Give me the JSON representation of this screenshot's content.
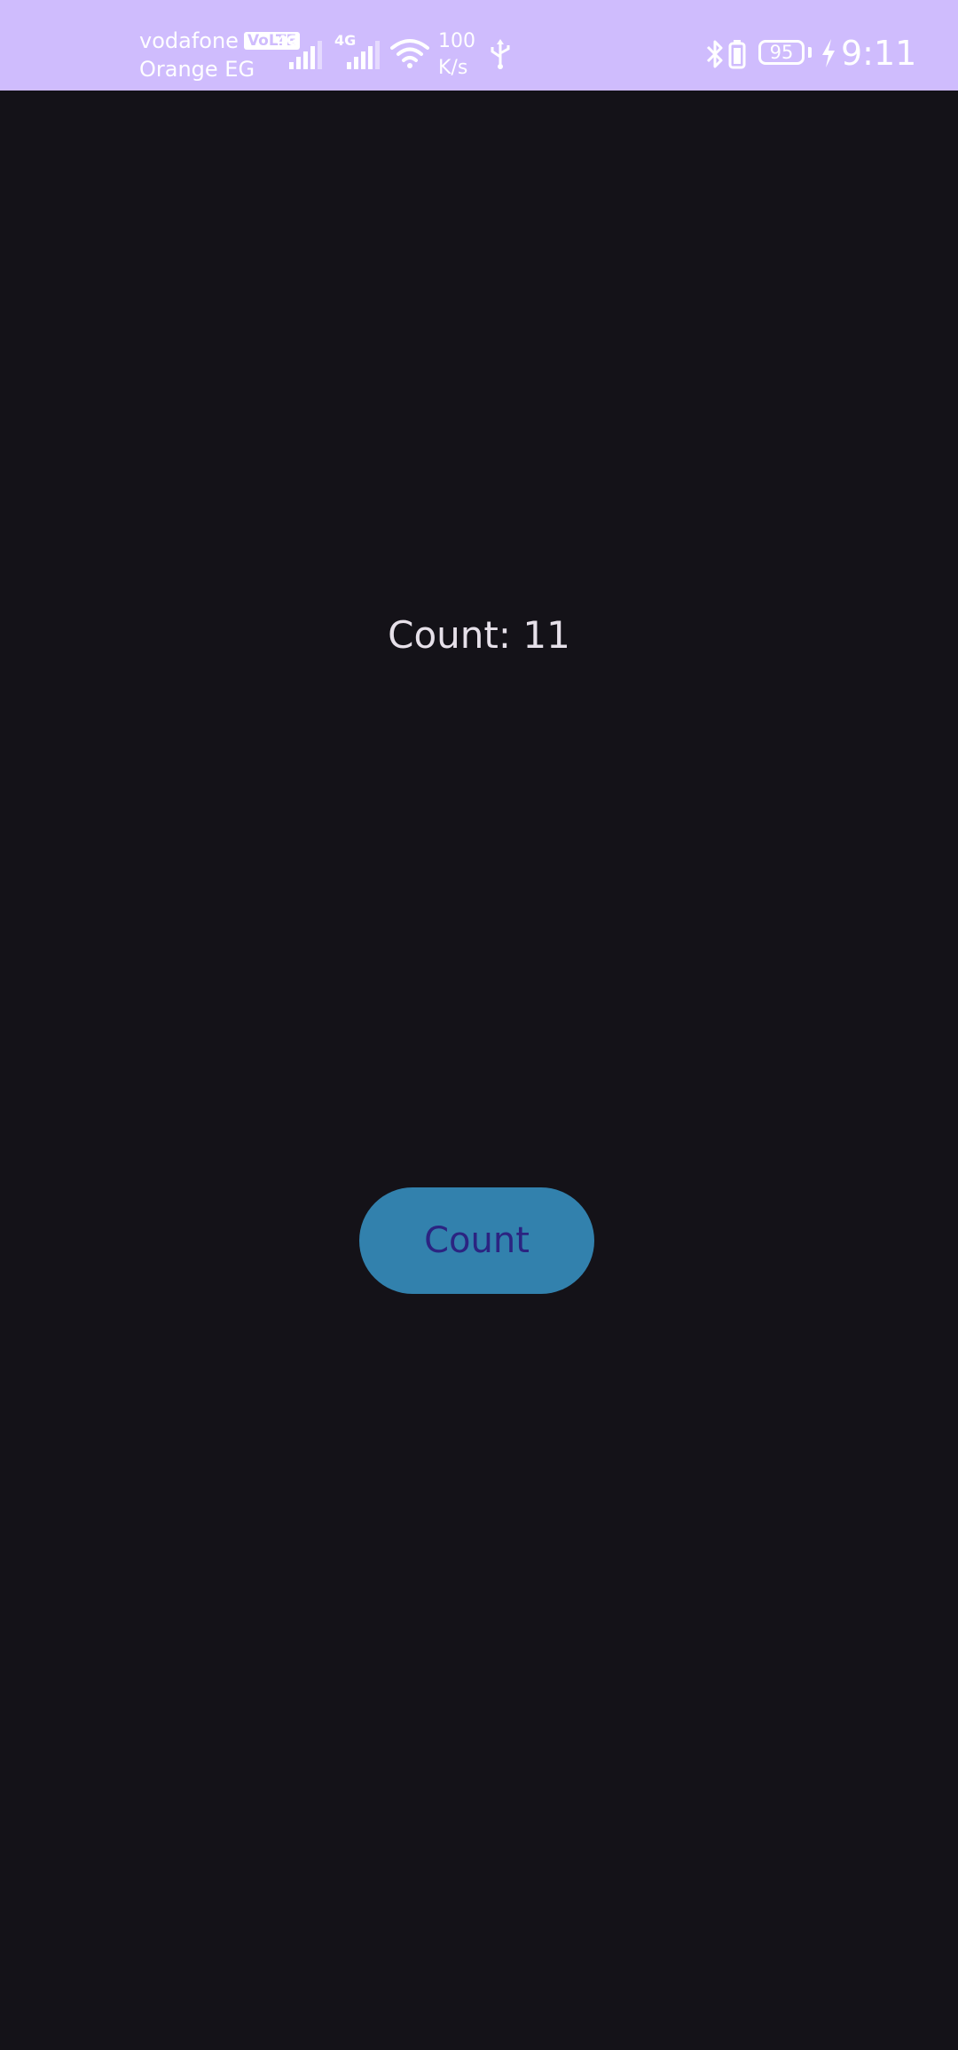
{
  "status_bar": {
    "carrier_1": "vodafone",
    "carrier_1_badge": "VoLTE",
    "carrier_2": "Orange EG",
    "sim1_network": "4G",
    "sim2_network": "4G",
    "speed_value": "100",
    "speed_unit": "K/s",
    "battery_level": "95",
    "time": "9:11",
    "icons": [
      "signal-icon",
      "wifi-icon",
      "usb-icon",
      "bluetooth-icon",
      "battery-icon",
      "charging-icon"
    ],
    "background_color": "#cfbcfd"
  },
  "main": {
    "count_label": "Count: 11",
    "button_label": "Count",
    "background_color": "#141218",
    "button_color": "#3281ad",
    "button_text_color": "#2b2481"
  }
}
